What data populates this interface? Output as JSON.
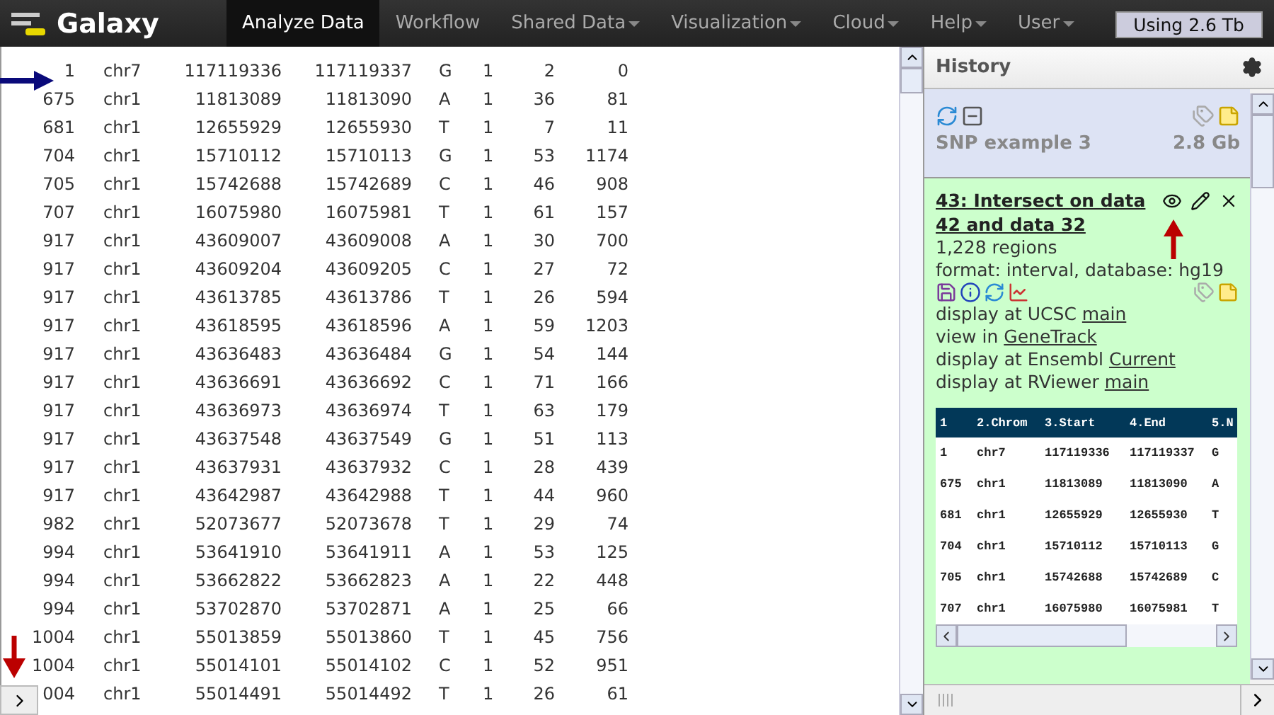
{
  "masthead": {
    "brand": "Galaxy",
    "tabs": [
      {
        "label": "Analyze Data",
        "selected": true,
        "dropdown": false
      },
      {
        "label": "Workflow",
        "selected": false,
        "dropdown": false
      },
      {
        "label": "Shared Data",
        "selected": false,
        "dropdown": true
      },
      {
        "label": "Visualization",
        "selected": false,
        "dropdown": true
      },
      {
        "label": "Cloud",
        "selected": false,
        "dropdown": true
      },
      {
        "label": "Help",
        "selected": false,
        "dropdown": true
      },
      {
        "label": "User",
        "selected": false,
        "dropdown": true
      }
    ],
    "quota": "Using 2.6 Tb"
  },
  "dataset_view": {
    "rows": [
      [
        "1",
        "chr7",
        "117119336",
        "117119337",
        "G",
        "1",
        "2",
        "0"
      ],
      [
        "675",
        "chr1",
        "11813089",
        "11813090",
        "A",
        "1",
        "36",
        "81"
      ],
      [
        "681",
        "chr1",
        "12655929",
        "12655930",
        "T",
        "1",
        "7",
        "11"
      ],
      [
        "704",
        "chr1",
        "15710112",
        "15710113",
        "G",
        "1",
        "53",
        "1174"
      ],
      [
        "705",
        "chr1",
        "15742688",
        "15742689",
        "C",
        "1",
        "46",
        "908"
      ],
      [
        "707",
        "chr1",
        "16075980",
        "16075981",
        "T",
        "1",
        "61",
        "157"
      ],
      [
        "917",
        "chr1",
        "43609007",
        "43609008",
        "A",
        "1",
        "30",
        "700"
      ],
      [
        "917",
        "chr1",
        "43609204",
        "43609205",
        "C",
        "1",
        "27",
        "72"
      ],
      [
        "917",
        "chr1",
        "43613785",
        "43613786",
        "T",
        "1",
        "26",
        "594"
      ],
      [
        "917",
        "chr1",
        "43618595",
        "43618596",
        "A",
        "1",
        "59",
        "1203"
      ],
      [
        "917",
        "chr1",
        "43636483",
        "43636484",
        "G",
        "1",
        "54",
        "144"
      ],
      [
        "917",
        "chr1",
        "43636691",
        "43636692",
        "C",
        "1",
        "71",
        "166"
      ],
      [
        "917",
        "chr1",
        "43636973",
        "43636974",
        "T",
        "1",
        "63",
        "179"
      ],
      [
        "917",
        "chr1",
        "43637548",
        "43637549",
        "G",
        "1",
        "51",
        "113"
      ],
      [
        "917",
        "chr1",
        "43637931",
        "43637932",
        "C",
        "1",
        "28",
        "439"
      ],
      [
        "917",
        "chr1",
        "43642987",
        "43642988",
        "T",
        "1",
        "44",
        "960"
      ],
      [
        "982",
        "chr1",
        "52073677",
        "52073678",
        "T",
        "1",
        "29",
        "74"
      ],
      [
        "994",
        "chr1",
        "53641910",
        "53641911",
        "A",
        "1",
        "53",
        "125"
      ],
      [
        "994",
        "chr1",
        "53662822",
        "53662823",
        "A",
        "1",
        "22",
        "448"
      ],
      [
        "994",
        "chr1",
        "53702870",
        "53702871",
        "A",
        "1",
        "25",
        "66"
      ],
      [
        "1004",
        "chr1",
        "55013859",
        "55013860",
        "T",
        "1",
        "45",
        "756"
      ],
      [
        "1004",
        "chr1",
        "55014101",
        "55014102",
        "C",
        "1",
        "52",
        "951"
      ],
      [
        "004",
        "chr1",
        "55014491",
        "55014492",
        "T",
        "1",
        "26",
        "61"
      ]
    ]
  },
  "history": {
    "title": "History",
    "datasets": [
      {
        "kind": "collapsed",
        "name": "SNP example 3",
        "size": "2.8 Gb"
      },
      {
        "kind": "expanded",
        "title": "43: Intersect on data 42 and data 32",
        "summary": "1,228 regions",
        "info": "format: interval, database: hg19",
        "links": [
          {
            "text": "display at UCSC",
            "link": "main"
          },
          {
            "text": "view in",
            "link": "GeneTrack"
          },
          {
            "text": "display at Ensembl",
            "link": "Current"
          },
          {
            "text": "display at RViewer",
            "link": "main"
          }
        ],
        "peek": {
          "columns": [
            "1",
            "2.Chrom",
            "3.Start",
            "4.End",
            "5.N"
          ],
          "rows": [
            [
              "1",
              "chr7",
              "117119336",
              "117119337",
              "G"
            ],
            [
              "675",
              "chr1",
              "11813089",
              "11813090",
              "A"
            ],
            [
              "681",
              "chr1",
              "12655929",
              "12655930",
              "T"
            ],
            [
              "704",
              "chr1",
              "15710112",
              "15710113",
              "G"
            ],
            [
              "705",
              "chr1",
              "15742688",
              "15742689",
              "C"
            ],
            [
              "707",
              "chr1",
              "16075980",
              "16075981",
              "T"
            ]
          ]
        }
      }
    ]
  }
}
